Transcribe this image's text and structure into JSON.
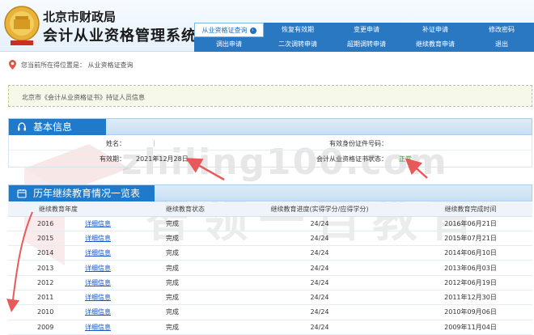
{
  "header": {
    "title_line1": "北京市财政局",
    "title_line2": "会计从业资格管理系统"
  },
  "nav": {
    "row1": [
      "从业资格证查询",
      "恢复有效期",
      "变更申请",
      "补证申请",
      "修改密码"
    ],
    "row2": [
      "调出申请",
      "二次调转申请",
      "超期调转申请",
      "继续教育申请",
      "退出"
    ],
    "active": "从业资格证查询"
  },
  "breadcrumb": {
    "text": "您当前所在得位置是： 从业资格证查询"
  },
  "notice": {
    "text": "北京市《会计从业资格证书》持证人员信息"
  },
  "basic": {
    "heading": "基本信息",
    "name_label": "姓名：",
    "name_value": "|",
    "id_label": "有效身份证件号码：",
    "valid_label": "有效期：",
    "valid_value": "2021年12月28日",
    "status_label": "会计从业资格证书状态：",
    "status_value": "正常"
  },
  "history": {
    "heading": "历年继续教育情况一览表",
    "columns": [
      "继续教育年度",
      "继续教育状态",
      "继续教育进度(实得学分/应得学分)",
      "继续教育完成时间"
    ],
    "link_label": "详细信息",
    "rows": [
      {
        "year": "2016",
        "state": "完成",
        "progress": "24/24",
        "date": "2016年06月21日"
      },
      {
        "year": "2015",
        "state": "完成",
        "progress": "24/24",
        "date": "2015年07月21日"
      },
      {
        "year": "2014",
        "state": "完成",
        "progress": "24/24",
        "date": "2014年06月10日"
      },
      {
        "year": "2013",
        "state": "完成",
        "progress": "24/24",
        "date": "2013年06月03日"
      },
      {
        "year": "2012",
        "state": "完成",
        "progress": "24/24",
        "date": "2012年06月19日"
      },
      {
        "year": "2011",
        "state": "完成",
        "progress": "24/24",
        "date": "2011年12月30日"
      },
      {
        "year": "2010",
        "state": "完成",
        "progress": "24/24",
        "date": "2010年09月06日"
      },
      {
        "year": "2009",
        "state": "完成",
        "progress": "24/24",
        "date": "2009年11月04日"
      }
    ]
  },
  "watermark": {
    "line1": "zhiling100.com",
    "line2": "智领一百教育"
  },
  "colors": {
    "nav_blue": "#2b78c2",
    "tab_blue": "#1f7acb",
    "status_green": "#2e9b2e",
    "link_blue": "#1a55c6",
    "annotation_red": "#e85a5a"
  }
}
